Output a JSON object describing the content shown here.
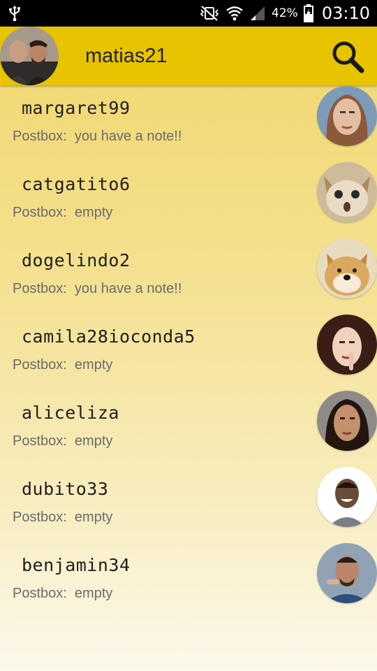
{
  "status_bar": {
    "battery_percent": "42%",
    "time": "03:10"
  },
  "app_bar": {
    "username": "matias21"
  },
  "contacts": [
    {
      "name": "margaret99",
      "status": "Postbox:  you have a note!!",
      "avatar_colors": [
        "#c2a385",
        "#8a5a3a"
      ]
    },
    {
      "name": "catgatito6",
      "status": "Postbox:  empty",
      "avatar_colors": [
        "#e6d5b5",
        "#a88a5d"
      ]
    },
    {
      "name": "dogelindo2",
      "status": "Postbox:  you have a note!!",
      "avatar_colors": [
        "#f2d49c",
        "#c48a3e"
      ]
    },
    {
      "name": "camila28ioconda5",
      "status": "Postbox:  empty",
      "avatar_colors": [
        "#e9c8b4",
        "#5a2a1c"
      ]
    },
    {
      "name": "aliceliza",
      "status": "Postbox:  empty",
      "avatar_colors": [
        "#b5825f",
        "#2a1a14"
      ]
    },
    {
      "name": "dubito33",
      "status": "Postbox:  empty",
      "avatar_colors": [
        "#ffffff",
        "#6a4a38"
      ]
    },
    {
      "name": "benjamin34",
      "status": "Postbox:  empty",
      "avatar_colors": [
        "#8fa3b5",
        "#6e4c3a"
      ]
    }
  ]
}
